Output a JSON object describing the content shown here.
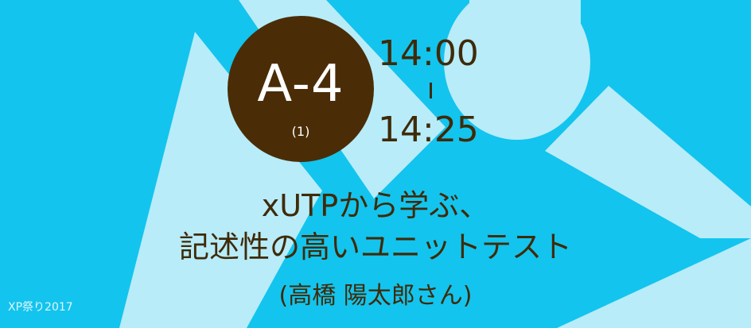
{
  "session": {
    "code": "A-4",
    "part": "(1)",
    "time_start": "14:00",
    "time_end": "14:25"
  },
  "talk": {
    "title_line1": "xUTPから学ぶ、",
    "title_line2": "記述性の高いユニットテスト",
    "speaker": "(高橋 陽太郎さん)"
  },
  "event": {
    "name": "XP祭り2017"
  },
  "colors": {
    "background": "#13c4ee",
    "shape": "#b8ecf9",
    "badge": "#4a2d07",
    "text": "#3f2a08"
  }
}
